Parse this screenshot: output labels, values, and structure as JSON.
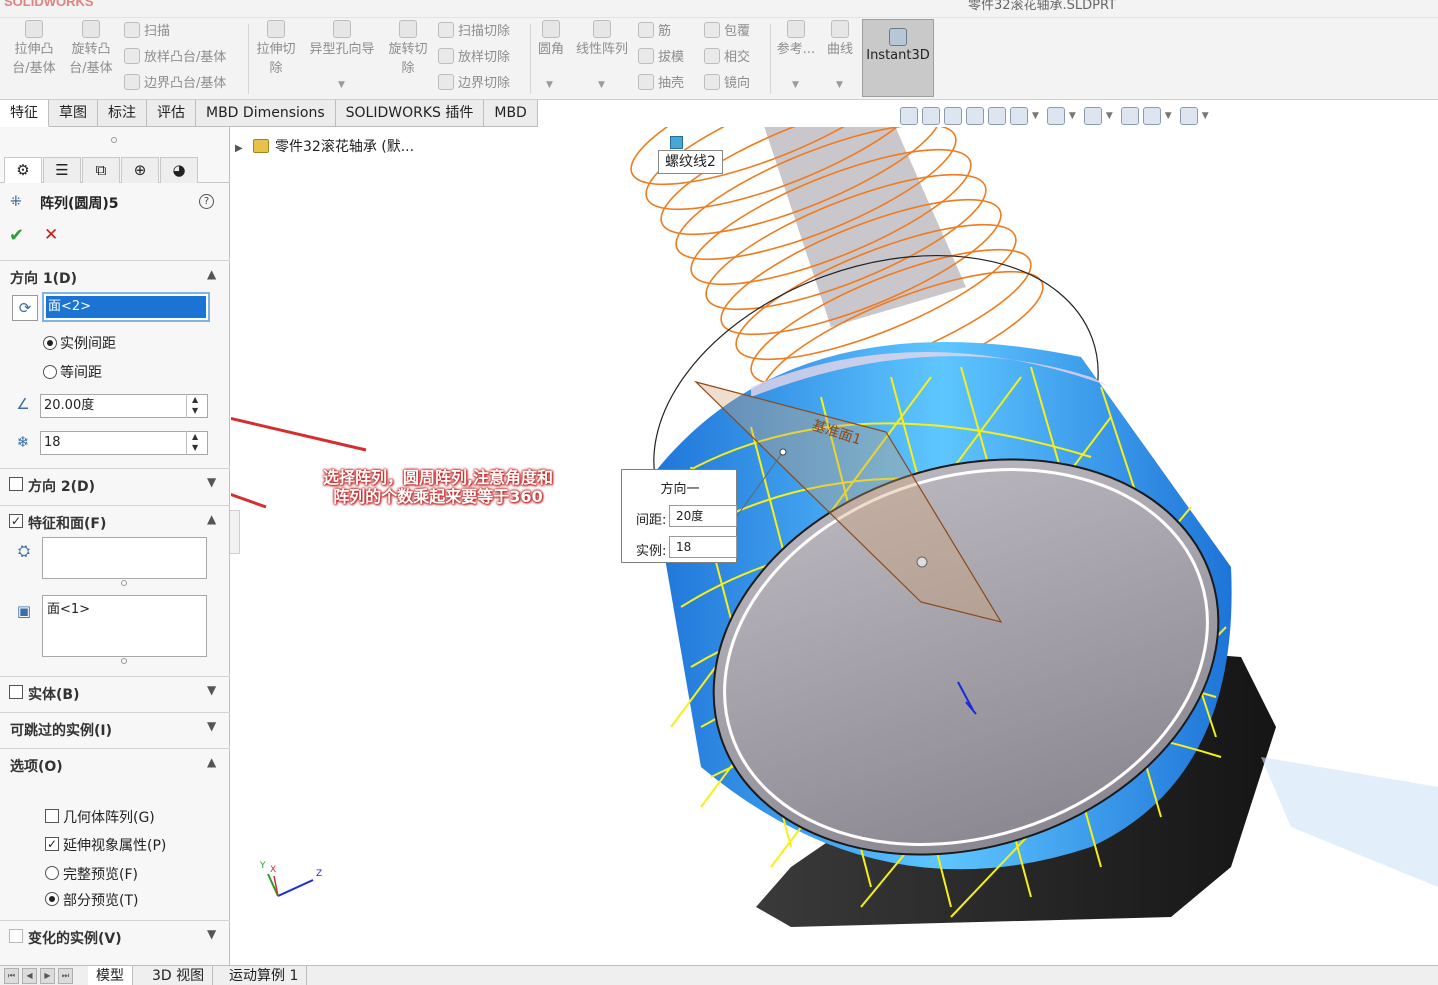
{
  "app": {
    "brand": "SOLIDWORKS",
    "doc_title": "零件32滚花轴承.SLDPRT"
  },
  "ribbon": {
    "extrude_boss": "拉伸凸\n台/基体",
    "revolve_boss": "旋转凸\n台/基体",
    "sweep": "扫描",
    "loft_boss": "放样凸台/基体",
    "boundary_boss": "边界凸台/基体",
    "extrude_cut": "拉伸切\n除",
    "hole_wizard": "异型孔向导",
    "revolve_cut": "旋转切\n除",
    "swept_cut": "扫描切除",
    "lofted_cut": "放样切除",
    "boundary_cut": "边界切除",
    "fillet": "圆角",
    "linear_pattern": "线性阵列",
    "rib": "筋",
    "draft": "拔模",
    "shell": "抽壳",
    "wrap": "包覆",
    "intersect": "相交",
    "mirror": "镜向",
    "reference": "参考...",
    "curves": "曲线",
    "instant3d": "Instant3D"
  },
  "command_tabs": [
    "特征",
    "草图",
    "标注",
    "评估",
    "MBD Dimensions",
    "SOLIDWORKS 插件",
    "MBD"
  ],
  "pm": {
    "title": "阵列(圆周)5",
    "direction1": {
      "label": "方向 1(D)",
      "selection": "面<2>",
      "option_instance_spacing": "实例间距",
      "option_equal_spacing": "等间距",
      "angle": "20.00度",
      "count": "18"
    },
    "direction2": {
      "label": "方向 2(D)"
    },
    "features_faces": {
      "label": "特征和面(F)",
      "faces": "面<1>"
    },
    "bodies": {
      "label": "实体(B)"
    },
    "skip_instances": {
      "label": "可跳过的实例(I)"
    },
    "options": {
      "label": "选项(O)",
      "geometry_pattern": "几何体阵列(G)",
      "propagate_visual": "延伸视象属性(P)",
      "full_preview": "完整预览(F)",
      "partial_preview": "部分预览(T)"
    },
    "varied_instances": {
      "label": "变化的实例(V)"
    }
  },
  "tree": {
    "root": "零件32滚花轴承 (默..."
  },
  "viewport": {
    "helix_tooltip": "螺纹线2",
    "callout": {
      "title": "方向一",
      "spacing_label": "间距:",
      "spacing_value": "20度",
      "count_label": "实例:",
      "count_value": "18"
    },
    "plane_label": "基准面1",
    "annotation": "选择阵列，圆周阵列,注意角度和阵列的个数乘起来要等于360",
    "triad": {
      "x": "X",
      "y": "Y",
      "z": "Z"
    }
  },
  "bottom_tabs": [
    "模型",
    "3D 视图",
    "运动算例 1"
  ],
  "colors": {
    "pattern_yellow": "#f5f01a",
    "helix_orange": "#f07b1f",
    "face_blue": "#2f8fe6",
    "annotation_red": "#d32f2f"
  }
}
